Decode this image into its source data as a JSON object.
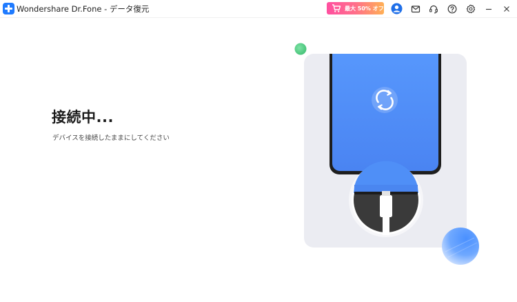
{
  "window": {
    "title": "Wondershare Dr.Fone - データ復元"
  },
  "promo": {
    "label": "最大 50% オフ",
    "gradient_start": "#ff4fa0",
    "gradient_end": "#ffb054"
  },
  "toolbar": {
    "icons": [
      "account-icon",
      "mail-icon",
      "support-headset-icon",
      "help-icon",
      "settings-icon",
      "minimize-icon",
      "close-icon"
    ]
  },
  "main": {
    "heading": "接続中...",
    "instruction": "デバイスを接続したままにしてください"
  },
  "colors": {
    "accent": "#1f7bff",
    "phone_screen": "#4f8ff7",
    "card_bg": "#ebecf2",
    "green_dot": "#53d38a"
  }
}
